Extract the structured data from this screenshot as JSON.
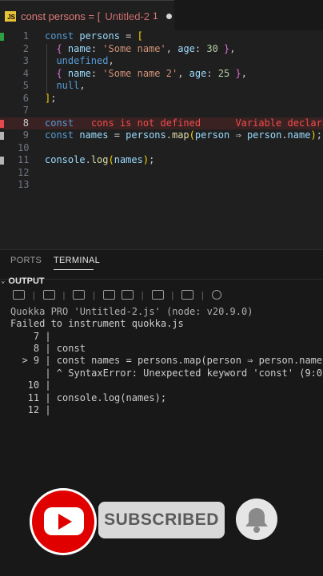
{
  "tab": {
    "badge": "JS",
    "title": "const persons = [",
    "file": "Untitled-2",
    "problem_count": "1"
  },
  "editor": {
    "lines": [
      {
        "n": "1",
        "tokens": [
          [
            "kw",
            "const "
          ],
          [
            "vr",
            "persons"
          ],
          [
            "pl",
            " = "
          ],
          [
            "yb",
            "["
          ]
        ]
      },
      {
        "n": "2",
        "tokens": [
          [
            "pl",
            "  "
          ],
          [
            "pb",
            "{"
          ],
          [
            "pl",
            " "
          ],
          [
            "vr",
            "name"
          ],
          [
            "pl",
            ": "
          ],
          [
            "st",
            "'Some name'"
          ],
          [
            "pl",
            ", "
          ],
          [
            "vr",
            "age"
          ],
          [
            "pl",
            ": "
          ],
          [
            "nm",
            "30"
          ],
          [
            "pl",
            " "
          ],
          [
            "pb",
            "}"
          ],
          [
            "pl",
            ","
          ]
        ]
      },
      {
        "n": "3",
        "tokens": [
          [
            "pl",
            "  "
          ],
          [
            "kw",
            "undefined"
          ],
          [
            "pl",
            ","
          ]
        ]
      },
      {
        "n": "4",
        "tokens": [
          [
            "pl",
            "  "
          ],
          [
            "pb",
            "{"
          ],
          [
            "pl",
            " "
          ],
          [
            "vr",
            "name"
          ],
          [
            "pl",
            ": "
          ],
          [
            "st",
            "'Some name 2'"
          ],
          [
            "pl",
            ", "
          ],
          [
            "vr",
            "age"
          ],
          [
            "pl",
            ": "
          ],
          [
            "nm",
            "25"
          ],
          [
            "pl",
            " "
          ],
          [
            "pb",
            "}"
          ],
          [
            "pl",
            ","
          ]
        ]
      },
      {
        "n": "5",
        "tokens": [
          [
            "pl",
            "  "
          ],
          [
            "kw",
            "null"
          ],
          [
            "pl",
            ","
          ]
        ]
      },
      {
        "n": "6",
        "tokens": [
          [
            "yb",
            "]"
          ],
          [
            "pl",
            ";"
          ]
        ]
      },
      {
        "n": "7",
        "tokens": []
      },
      {
        "n": "8",
        "tokens": [
          [
            "kw",
            "const"
          ],
          [
            "pl",
            "   "
          ],
          [
            "err",
            "cons is not defined"
          ],
          [
            "pl",
            "      "
          ],
          [
            "err",
            "Variable declara"
          ]
        ]
      },
      {
        "n": "9",
        "tokens": [
          [
            "kw",
            "const "
          ],
          [
            "vr",
            "names"
          ],
          [
            "pl",
            " = "
          ],
          [
            "vr",
            "persons"
          ],
          [
            "pl",
            "."
          ],
          [
            "fn",
            "map"
          ],
          [
            "yb",
            "("
          ],
          [
            "vr",
            "person"
          ],
          [
            "pl",
            " ⇒ "
          ],
          [
            "vr",
            "person"
          ],
          [
            "pl",
            "."
          ],
          [
            "vr",
            "name"
          ],
          [
            "yb",
            ")"
          ],
          [
            "pl",
            ";"
          ]
        ]
      },
      {
        "n": "10",
        "tokens": []
      },
      {
        "n": "11",
        "tokens": [
          [
            "vr",
            "console"
          ],
          [
            "pl",
            "."
          ],
          [
            "fn",
            "log"
          ],
          [
            "yb",
            "("
          ],
          [
            "vr",
            "names"
          ],
          [
            "yb",
            ")"
          ],
          [
            "pl",
            ";"
          ]
        ]
      },
      {
        "n": "12",
        "tokens": []
      },
      {
        "n": "13",
        "tokens": []
      }
    ]
  },
  "panel": {
    "tabs": [
      "PORTS",
      "TERMINAL"
    ],
    "output_label": "OUTPUT",
    "terminal_lines": [
      "Quokka PRO 'Untitled-2.js' (node: v20.9.0)",
      "Failed to instrument quokka.js",
      "    7 |",
      "    8 | const",
      "  > 9 | const names = persons.map(person ⇒ person.name)",
      "      | ^ SyntaxError: Unexpected keyword 'const' (9:0)",
      "   10 |",
      "   11 | console.log(names);",
      "   12 |"
    ]
  },
  "overlay": {
    "subscribe_label": "SUBSCRIBED"
  },
  "colors": {
    "background": "#1f1f1f",
    "error": "#f14c4c",
    "youtube_red": "#e00000"
  }
}
